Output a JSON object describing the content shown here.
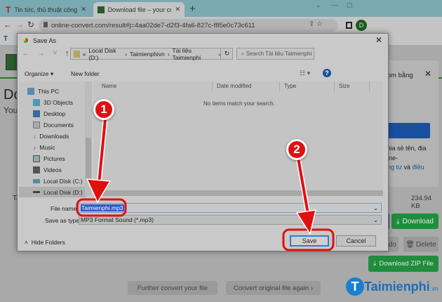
{
  "browser": {
    "tabs": [
      {
        "label": "Tin tức, thủ thuật công nghệ mới",
        "icon": "T"
      },
      {
        "label": "Download file – your conversion"
      }
    ],
    "url": "online-convert.com/result#j=4aa02de7-d2f3-4fa6-827c-f85e0c73c611",
    "profile": "D",
    "bookmark": "T"
  },
  "page": {
    "heading": "Do",
    "subheading": "Your",
    "popup": {
      "text1": "com bằng",
      "text2": "chia sẻ tên, địa",
      "text3": "nline-",
      "link": "iêng tư",
      "and": " và ",
      "link2": "điều"
    },
    "file_label": "Ta",
    "size": "234.94 KB",
    "download": "Download",
    "redo": "edo",
    "delete": "Delete",
    "zip": "Download ZIP File",
    "further": "Further convert your file",
    "convert_again": "Convert original file again"
  },
  "dialog": {
    "title": "Save As",
    "breadcrumb": [
      "Local Disk (D:)",
      "Taimienphivn",
      "Tài liệu Taimienphi"
    ],
    "search_placeholder": "Search Tài liệu Taimienphi",
    "organize": "Organize",
    "new_folder": "New folder",
    "columns": [
      "Name",
      "Date modified",
      "Type",
      "Size"
    ],
    "empty": "No items match your search.",
    "nav": [
      "This PC",
      "3D Objects",
      "Desktop",
      "Documents",
      "Downloads",
      "Music",
      "Pictures",
      "Videos",
      "Local Disk (C:)",
      "Local Disk (D:)"
    ],
    "file_name_label": "File name:",
    "file_name": "Taimienphi.mp3",
    "type_label": "Save as type:",
    "type": "MP3 Format Sound (*.mp3)",
    "hide_folders": "Hide Folders",
    "save": "Save",
    "cancel": "Cancel"
  },
  "annotations": {
    "step1": "1",
    "step2": "2"
  },
  "watermark": {
    "text": "Taimienphi",
    "suffix": ".vn"
  }
}
